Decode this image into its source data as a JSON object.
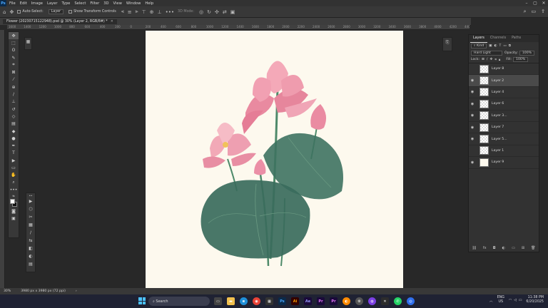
{
  "app": {
    "logo": "Ps"
  },
  "menu": [
    "File",
    "Edit",
    "Image",
    "Layer",
    "Type",
    "Select",
    "Filter",
    "3D",
    "View",
    "Window",
    "Help"
  ],
  "options": {
    "auto_select_label": "Auto-Select:",
    "auto_select_value": "Layer",
    "transform_label": "Show Transform Controls",
    "mode_3d": "3D Mode:"
  },
  "document": {
    "tab_title": "Flower (20230715122948).psd @ 30% (Layer 2, RGB/8#) *"
  },
  "ruler": {
    "ticks": [
      "1600",
      "1400",
      "1200",
      "1000",
      "800",
      "600",
      "400",
      "200",
      "0",
      "200",
      "400",
      "600",
      "800",
      "1000",
      "1200",
      "1400",
      "1600",
      "1800",
      "2000",
      "2200",
      "2400",
      "2600",
      "2800",
      "3000",
      "3200",
      "3400",
      "3600",
      "3800",
      "4000",
      "4200",
      "4400"
    ]
  },
  "layers_panel": {
    "tabs": [
      "Layers",
      "Channels",
      "Paths"
    ],
    "kind_label": "Kind",
    "blend_mode": "Hard Light",
    "opacity_label": "Opacity:",
    "opacity_value": "100%",
    "lock_label": "Lock:",
    "fill_label": "Fill:",
    "fill_value": "100%",
    "layers": [
      {
        "name": "Layer 8",
        "visible": false,
        "selected": false,
        "thumb": "checker"
      },
      {
        "name": "Layer 2",
        "visible": true,
        "selected": true,
        "thumb": "checker"
      },
      {
        "name": "Layer 4",
        "visible": true,
        "selected": false,
        "thumb": "checker"
      },
      {
        "name": "Layer 6",
        "visible": true,
        "selected": false,
        "thumb": "checker"
      },
      {
        "name": "Layer 3...",
        "visible": true,
        "selected": false,
        "thumb": "checker"
      },
      {
        "name": "Layer 7",
        "visible": true,
        "selected": false,
        "thumb": "checker"
      },
      {
        "name": "Layer 5...",
        "visible": true,
        "selected": false,
        "thumb": "checker"
      },
      {
        "name": "Layer 1",
        "visible": false,
        "selected": false,
        "thumb": "checker"
      },
      {
        "name": "Layer 9",
        "visible": true,
        "selected": false,
        "thumb": "white"
      }
    ]
  },
  "status": {
    "zoom": "30%",
    "doc_size": "3980 px x 3980 px (72 ppi)"
  },
  "taskbar": {
    "search_placeholder": "Search",
    "lang_line1": "ENG",
    "lang_line2": "US",
    "time": "11:38 PM",
    "date": "6/20/2025",
    "apps": [
      {
        "name": "Ps",
        "color": "#0b2a4a",
        "text_color": "#4aa8ff"
      },
      {
        "name": "Ai",
        "color": "#330000",
        "text_color": "#ff9a00"
      },
      {
        "name": "Ae",
        "color": "#1a0a3a",
        "text_color": "#9999ff"
      },
      {
        "name": "Pr",
        "color": "#1a0a3a",
        "text_color": "#ea77ff"
      },
      {
        "name": "Pr",
        "color": "#1a0a3a",
        "text_color": "#ea77ff"
      }
    ]
  }
}
